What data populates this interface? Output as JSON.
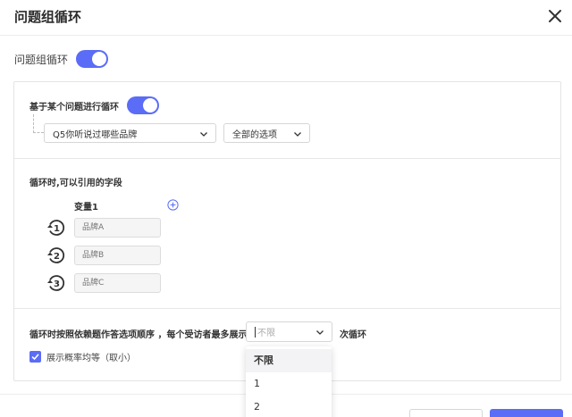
{
  "dialog": {
    "title": "问题组循环",
    "close_icon": "close-icon"
  },
  "group_loop": {
    "label": "问题组循环",
    "enabled": true
  },
  "loop_by_question": {
    "label": "基于某个问题进行循环",
    "enabled": true,
    "question_select": {
      "value": "Q5你听说过哪些品牌"
    },
    "option_select": {
      "value": "全部的选项"
    }
  },
  "fields": {
    "label": "循环时,可以引用的字段",
    "column_header": "变量1",
    "add_icon": "plus-circle-icon",
    "rows": [
      {
        "index": "1",
        "placeholder": "品牌A"
      },
      {
        "index": "2",
        "placeholder": "品牌B"
      },
      {
        "index": "3",
        "placeholder": "品牌C"
      }
    ]
  },
  "limit": {
    "label": "循环时按照依赖题作答选项顺序 ，每个受访者最多展示",
    "select_value": "不限",
    "suffix": "次循环",
    "options": [
      "不限",
      "1",
      "2"
    ]
  },
  "equal_prob": {
    "label": "展示概率均等（取小）",
    "checked": true
  },
  "colors": {
    "accent": "#5b6cf6",
    "border": "#e4e4e4"
  }
}
